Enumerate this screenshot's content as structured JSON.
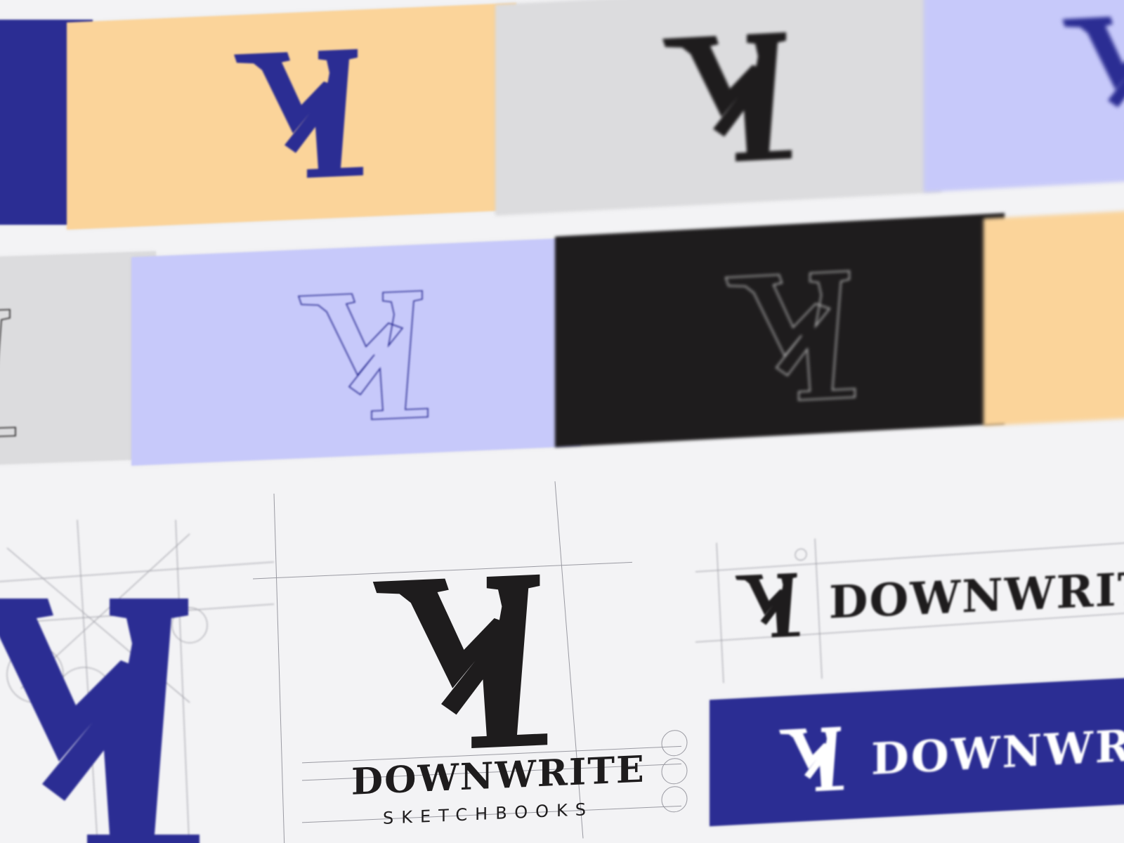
{
  "brand": {
    "name": "DOWNWRITE",
    "tagline": "SKETCHBOOKS",
    "name_partial_1": "DOWNWRIT",
    "name_partial_2": "DOWNWR"
  },
  "colors": {
    "navy": "#2b2d93",
    "peach": "#fbd49a",
    "lavender": "#c7c9fa",
    "light_gray": "#dcdcde",
    "black": "#1e1c1d",
    "paper": "#f3f3f5",
    "white": "#ffffff"
  },
  "icons": {
    "monogram": "dw-monogram-icon"
  },
  "swatches": [
    {
      "label": "navy-fill",
      "background": "navy",
      "mark": "white-solid"
    },
    {
      "label": "peach-fill",
      "background": "peach",
      "mark": "navy-solid"
    },
    {
      "label": "gray-fill",
      "background": "light_gray",
      "mark": "black-solid"
    },
    {
      "label": "lavender-fill",
      "background": "lavender",
      "mark": "navy-solid"
    },
    {
      "label": "gray-outline",
      "background": "light_gray",
      "mark": "black-outline"
    },
    {
      "label": "lavender-outline",
      "background": "lavender",
      "mark": "navy-outline"
    },
    {
      "label": "black-outline",
      "background": "black",
      "mark": "gray-outline"
    },
    {
      "label": "peach-fill-2",
      "background": "peach",
      "mark": "none"
    }
  ]
}
